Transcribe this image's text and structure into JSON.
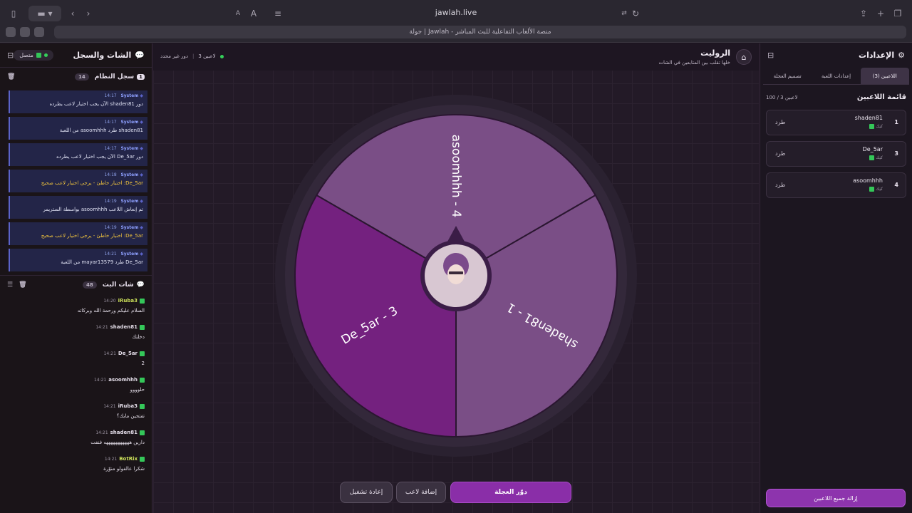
{
  "browser": {
    "url": "jawlah.live",
    "tab_title": "جولة | Jawlah - منصة الألعاب التفاعلية للبث المباشر"
  },
  "chat_panel": {
    "title": "الشات والسجل",
    "status": "متصل",
    "system_log": {
      "title": "سجل النظام",
      "count": "14",
      "badge": "1",
      "entries": [
        {
          "time": "14:17",
          "author": "System",
          "text": "دور shaden81 الآن يجب اختيار لاعب يطرده",
          "warn": false
        },
        {
          "time": "14:17",
          "author": "System",
          "text": "shaden81 طرد asoomhhh من اللعبة",
          "warn": false
        },
        {
          "time": "14:17",
          "author": "System",
          "text": "دور De_5ar الآن يجب اختيار لاعب يطرده",
          "warn": false
        },
        {
          "time": "14:18",
          "author": "System",
          "text": "De_5ar: اختيار خاطئ - يرجى اختيار لاعب صحيح",
          "warn": true
        },
        {
          "time": "14:19",
          "author": "System",
          "text": "تم إنعاش اللاعب asoomhhh بواسطة الستريمر",
          "warn": false
        },
        {
          "time": "14:19",
          "author": "System",
          "text": "De_5ar: اختيار خاطئ - يرجى اختيار لاعب صحيح",
          "warn": true
        },
        {
          "time": "14:21",
          "author": "System",
          "text": "De_5ar طرد mayar13579 من اللعبة",
          "warn": false
        }
      ]
    },
    "live_chat": {
      "title": "شات البث",
      "count": "48",
      "messages": [
        {
          "time": "14:20",
          "author": "iRuba3",
          "text": "السلام عليكم ورحمة الله وبركاته",
          "hl": true
        },
        {
          "time": "14:21",
          "author": "shaden81",
          "text": "دخلتك",
          "hl": false
        },
        {
          "time": "14:21",
          "author": "De_5ar",
          "text": "2",
          "hl": false
        },
        {
          "time": "14:21",
          "author": "asoomhhh",
          "text": "حلوووو",
          "hl": false
        },
        {
          "time": "14:21",
          "author": "iRuba3",
          "text": "تفتحين مايك؟",
          "hl": false
        },
        {
          "time": "14:21",
          "author": "shaden81",
          "text": "دارين هههههههههههه فنفت",
          "hl": false
        },
        {
          "time": "14:21",
          "author": "BotRix",
          "text": "شكرا عالفولو منوّرة",
          "hl": true
        }
      ]
    }
  },
  "main": {
    "title": "الروليت",
    "subtitle": "خلها تقلب بين المتابعين في الشات",
    "players_count": "3 لاعبين",
    "turn": "دور غير محدد",
    "wheel": {
      "segments": [
        {
          "label": "asoomhhh - 4",
          "color": "#7a4e86"
        },
        {
          "label": "shaden81 - 1",
          "color": "#7a4e86"
        },
        {
          "label": "De_5ar - 3",
          "color": "#74217f"
        }
      ]
    },
    "buttons": {
      "spin": "دوّر العجلة",
      "add_player": "إضافة لاعب",
      "restart": "إعادة تشغيل"
    }
  },
  "settings": {
    "title": "الإعدادات",
    "tabs": [
      "اللاعبين (3)",
      "إعدادات اللعبة",
      "تصميم العجلة"
    ],
    "list_title": "قائمة اللاعبين",
    "list_count": "100 / 3 لاعبين",
    "players": [
      {
        "num": "1",
        "name": "shaden81",
        "sub": "كيك",
        "kick": "طرد"
      },
      {
        "num": "3",
        "name": "De_5ar",
        "sub": "كيك",
        "kick": "طرد"
      },
      {
        "num": "4",
        "name": "asoomhhh",
        "sub": "كيك",
        "kick": "طرد"
      }
    ],
    "remove_all": "إزالة جميع اللاعبين"
  },
  "colors": {
    "accent": "#8a2ea8",
    "green": "#35d05a",
    "warn": "#f2c53d"
  }
}
